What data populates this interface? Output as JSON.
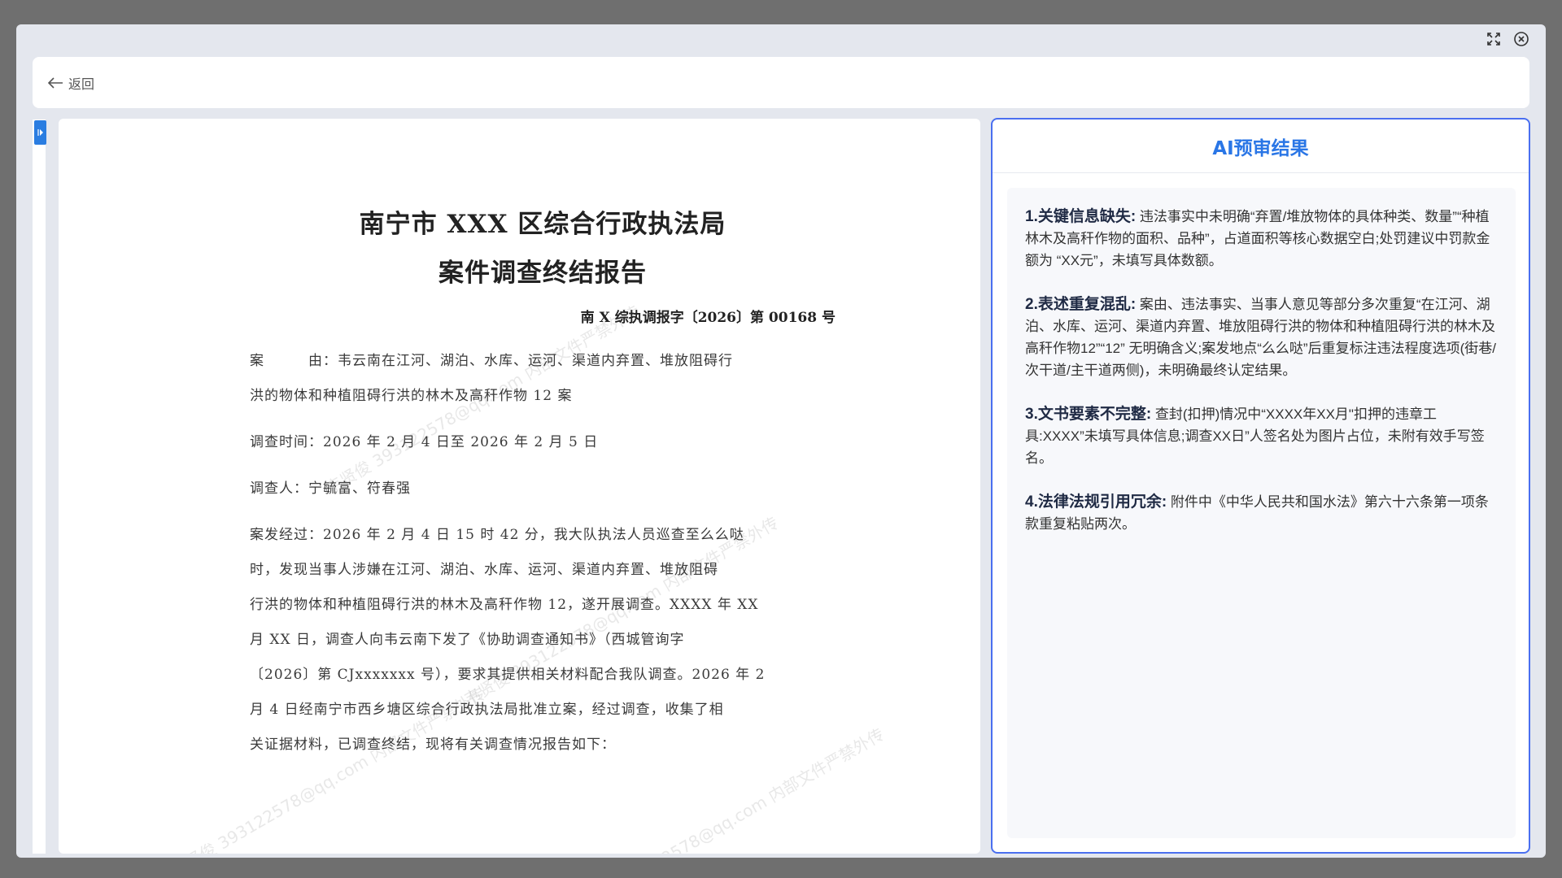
{
  "topbar": {
    "back_label": "返回"
  },
  "document": {
    "title_line1": "南宁市 XXX 区综合行政执法局",
    "title_line2": "案件调查终结报告",
    "doc_number": "南 X 综执调报字〔2026〕第 00168 号",
    "paragraphs": [
      "案　　　由：韦云南在江河、湖泊、水库、运河、渠道内弃置、堆放阻碍行",
      "洪的物体和种植阻碍行洪的林木及高秆作物 12 案",
      "调查时间：2026 年 2 月 4 日至 2026 年 2 月 5 日",
      "调查人：宁毓富、符春强",
      "案发经过：2026 年 2 月 4 日 15 时 42 分，我大队执法人员巡查至么么哒",
      "时，发现当事人涉嫌在江河、湖泊、水库、运河、渠道内弃置、堆放阻碍",
      "行洪的物体和种植阻碍行洪的林木及高秆作物 12，遂开展调查。XXXX 年 XX",
      "月 XX 日，调查人向韦云南下发了《协助调查通知书》（西城管询字",
      "〔2026〕第 CJxxxxxxx 号），要求其提供相关材料配合我队调查。2026 年 2",
      "月 4 日经南宁市西乡塘区综合行政执法局批准立案，经过调查，收集了相",
      "关证据材料，已调查终结，现将有关调查情况报告如下："
    ],
    "watermark": "韦贤俊 393122578@qq.com 内部文件严禁外传"
  },
  "ai_panel": {
    "title": "AI预审结果",
    "issues": [
      {
        "heading": "1.关键信息缺失:",
        "text": " 违法事实中未明确“弃置/堆放物体的具体种类、数量”“种植林木及高秆作物的面积、品种”，占道面积等核心数据空白;处罚建议中罚款金额为 “XX元”，未填写具体数额。"
      },
      {
        "heading": "2.表述重复混乱:",
        "text": " 案由、违法事实、当事人意见等部分多次重复“在江河、湖泊、水库、运河、渠道内弃置、堆放阻碍行洪的物体和种植阻碍行洪的林木及高秆作物12”“12” 无明确含义;案发地点“么么哒”后重复标注违法程度选项(街巷/次干道/主干道两侧)，未明确最终认定结果。"
      },
      {
        "heading": "3.文书要素不完整:",
        "text": " 查封(扣押)情况中“XXXX年XX月\"扣押的违章工具:XXXX”未填写具体信息;调查XX日”人签名处为图片占位，未附有效手写签名。"
      },
      {
        "heading": "4.法律法规引用冗余:",
        "text": " 附件中《中华人民共和国水法》第六十六条第一项条款重复粘贴两次。"
      }
    ]
  },
  "colors": {
    "accent": "#2a76e6",
    "panel_border": "#4a6ff0",
    "overlay": "#6f6f6f"
  }
}
